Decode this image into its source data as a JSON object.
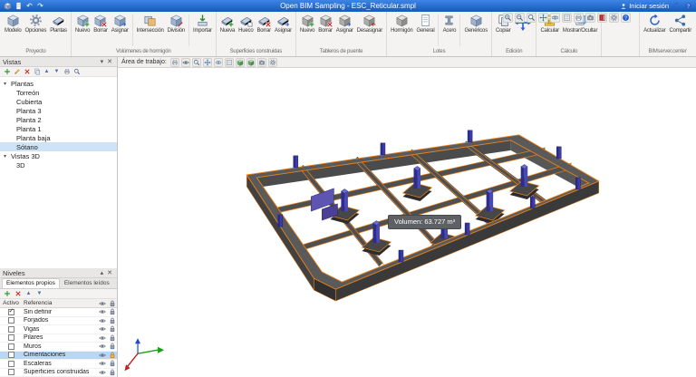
{
  "titlebar": {
    "title": "Open BIM Sampling - ESC_Reticular.smpl",
    "login": "Iniciar sesión"
  },
  "ribbon": {
    "proyecto": {
      "label": "Proyecto",
      "modelo": "Modelo",
      "opciones": "Opciones",
      "plantas": "Plantas"
    },
    "volumenes": {
      "label": "Volúmenes de hormigón",
      "nuevo": "Nuevo",
      "borrar": "Borrar",
      "asignar": "Asignar",
      "interseccion": "Intersección",
      "division": "División",
      "importar": "Importar"
    },
    "superficies": {
      "label": "Superficies construidas",
      "nueva": "Nueva",
      "hueco": "Hueco",
      "borrar": "Borrar",
      "asignar": "Asignar"
    },
    "tableros": {
      "label": "Tableros de puente",
      "nuevo": "Nuevo",
      "borrar": "Borrar",
      "asignar": "Asignar",
      "desasignar": "Desasignar"
    },
    "lotes": {
      "label": "Lotes",
      "hormigon": "Hormigón",
      "general": "General",
      "acero": "Acero",
      "genericos": "Genéricos"
    },
    "edicion": {
      "label": "Edición",
      "copiar": "Copiar"
    },
    "calculo": {
      "label": "Cálculo",
      "calcular": "Calcular",
      "mostrar": "Mostrar/Ocultar"
    },
    "bimserver": {
      "label": "BIMserver.center",
      "actualizar": "Actualizar",
      "compartir": "Compartir"
    }
  },
  "workspace": {
    "label": "Área de trabajo:"
  },
  "vistas": {
    "title": "Vistas",
    "plantas_label": "Plantas",
    "vistas3d_label": "Vistas 3D",
    "plantas": [
      {
        "label": "Torreón",
        "selected": false
      },
      {
        "label": "Cubierta",
        "selected": false
      },
      {
        "label": "Planta 3",
        "selected": false
      },
      {
        "label": "Planta 2",
        "selected": false
      },
      {
        "label": "Planta 1",
        "selected": false
      },
      {
        "label": "Planta baja",
        "selected": false
      },
      {
        "label": "Sótano",
        "selected": true
      }
    ],
    "vistas3d": [
      {
        "label": "3D",
        "selected": false
      }
    ]
  },
  "niveles": {
    "title": "Niveles",
    "tabs": {
      "propios": "Elementos propios",
      "leidos": "Elementos leídos"
    },
    "columns": {
      "activo": "Activo",
      "referencia": "Referencia"
    },
    "rows": [
      {
        "label": "Sin definir",
        "checked": true,
        "selected": false
      },
      {
        "label": "Forjados",
        "checked": false,
        "selected": false
      },
      {
        "label": "Vigas",
        "checked": false,
        "selected": false
      },
      {
        "label": "Pilares",
        "checked": false,
        "selected": false
      },
      {
        "label": "Muros",
        "checked": false,
        "selected": false
      },
      {
        "label": "Cimentaciones",
        "checked": false,
        "selected": true
      },
      {
        "label": "Escaleras",
        "checked": false,
        "selected": false
      },
      {
        "label": "Superficies construidas",
        "checked": false,
        "selected": false
      }
    ]
  },
  "viewport": {
    "tooltip": "Volumen: 63.727 m³"
  },
  "colors": {
    "titlebar_blue": "#1b66cf",
    "accent_orange": "#e8821c",
    "column_purple": "#3c3cab",
    "selection_blue": "#b9d6f2"
  }
}
